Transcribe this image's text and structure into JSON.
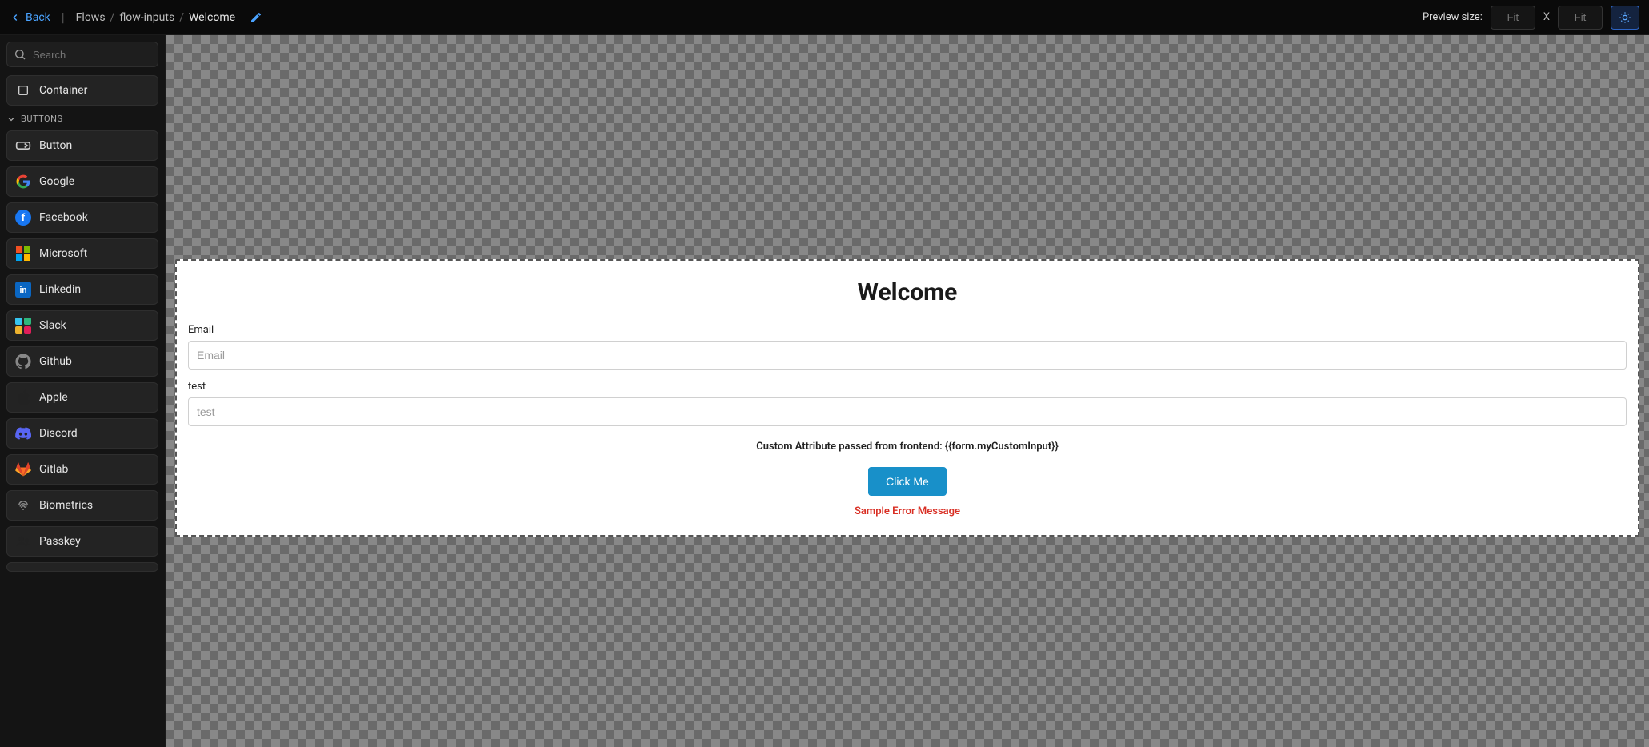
{
  "topbar": {
    "back_label": "Back",
    "breadcrumb": [
      "Flows",
      "flow-inputs",
      "Welcome"
    ],
    "preview_label": "Preview size:",
    "width_placeholder": "Fit",
    "height_placeholder": "Fit",
    "x_label": "X"
  },
  "sidebar": {
    "search_placeholder": "Search",
    "container_label": "Container",
    "buttons_section": "BUTTONS",
    "items": [
      {
        "label": "Button",
        "icon": "button-icon"
      },
      {
        "label": "Google",
        "icon": "google-icon"
      },
      {
        "label": "Facebook",
        "icon": "facebook-icon"
      },
      {
        "label": "Microsoft",
        "icon": "microsoft-icon"
      },
      {
        "label": "Linkedin",
        "icon": "linkedin-icon"
      },
      {
        "label": "Slack",
        "icon": "slack-icon"
      },
      {
        "label": "Github",
        "icon": "github-icon"
      },
      {
        "label": "Apple",
        "icon": "apple-icon"
      },
      {
        "label": "Discord",
        "icon": "discord-icon"
      },
      {
        "label": "Gitlab",
        "icon": "gitlab-icon"
      },
      {
        "label": "Biometrics",
        "icon": "biometrics-icon"
      },
      {
        "label": "Passkey",
        "icon": "passkey-icon"
      }
    ]
  },
  "page": {
    "title": "Welcome",
    "fields": [
      {
        "label": "Email",
        "placeholder": "Email"
      },
      {
        "label": "test",
        "placeholder": "test"
      }
    ],
    "custom_attr_text": "Custom Attribute passed from frontend: {{form.myCustomInput}}",
    "cta_label": "Click Me",
    "error_text": "Sample Error Message"
  }
}
